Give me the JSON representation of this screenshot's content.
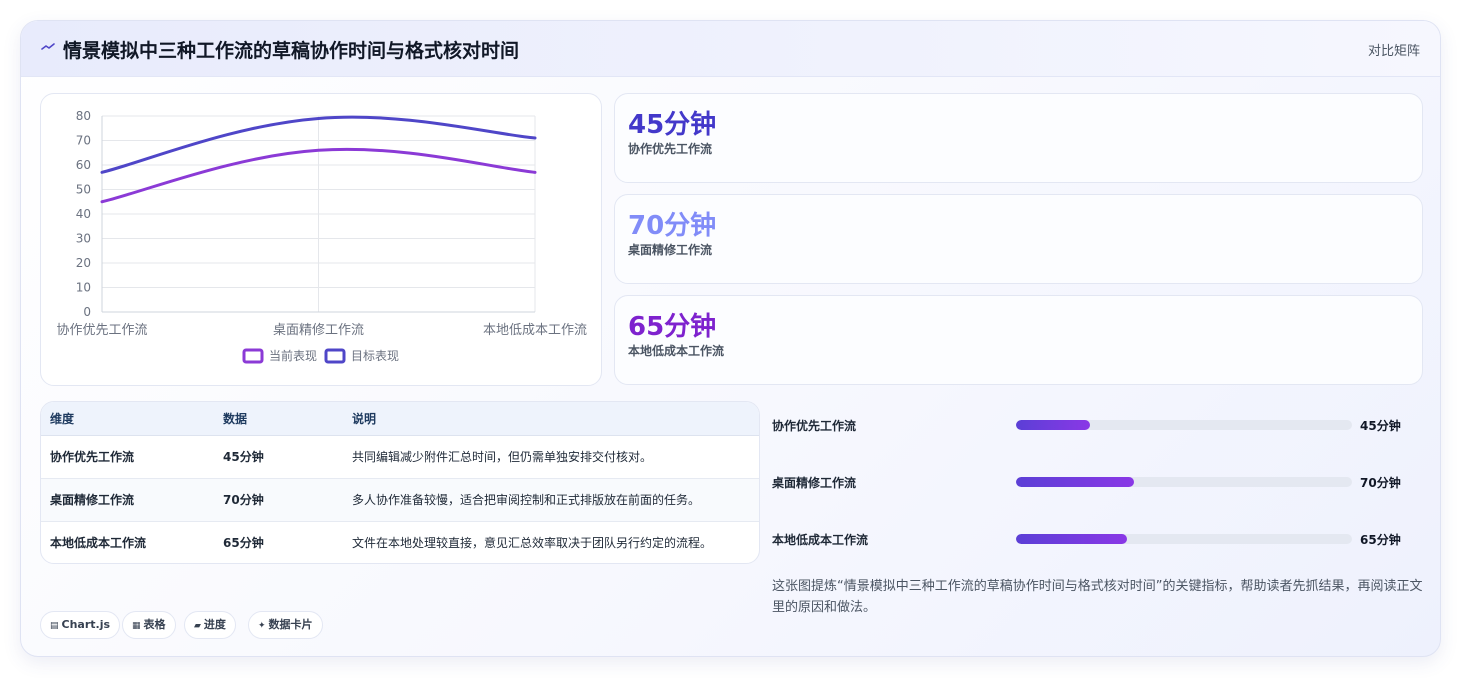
{
  "header": {
    "title": "情景模拟中三种工作流的草稿协作时间与格式核对时间",
    "tag": "对比矩阵"
  },
  "colors": {
    "current": "#8b3ad6",
    "target": "#4f46c8",
    "stat1": "#4338ca",
    "stat2": "#818cf8",
    "stat3": "#7e22ce"
  },
  "chart_data": {
    "type": "line",
    "categories": [
      "协作优先工作流",
      "桌面精修工作流",
      "本地低成本工作流"
    ],
    "series": [
      {
        "name": "当前表现",
        "values": [
          45,
          66,
          57
        ]
      },
      {
        "name": "目标表现",
        "values": [
          57,
          79,
          71
        ]
      }
    ],
    "ylim": [
      0,
      80
    ],
    "yticks": [
      "0",
      "10",
      "20",
      "30",
      "40",
      "50",
      "60",
      "70",
      "80"
    ],
    "grid": true,
    "legend": "bottom"
  },
  "stats": [
    {
      "value": "45分钟",
      "label": "协作优先工作流"
    },
    {
      "value": "70分钟",
      "label": "桌面精修工作流"
    },
    {
      "value": "65分钟",
      "label": "本地低成本工作流"
    }
  ],
  "table": {
    "headers": [
      "维度",
      "数据",
      "说明"
    ],
    "rows": [
      [
        "协作优先工作流",
        "45分钟",
        "共同编辑减少附件汇总时间，但仍需单独安排交付核对。"
      ],
      [
        "桌面精修工作流",
        "70分钟",
        "多人协作准备较慢，适合把审阅控制和正式排版放在前面的任务。"
      ],
      [
        "本地低成本工作流",
        "65分钟",
        "文件在本地处理较直接，意见汇总效率取决于团队另行约定的流程。"
      ]
    ]
  },
  "progress": [
    {
      "label": "协作优先工作流",
      "value": "45分钟",
      "fraction": 0.22
    },
    {
      "label": "桌面精修工作流",
      "value": "70分钟",
      "fraction": 0.35
    },
    {
      "label": "本地低成本工作流",
      "value": "65分钟",
      "fraction": 0.33
    }
  ],
  "note": "这张图提炼“情景模拟中三种工作流的草稿协作时间与格式核对时间”的关键指标，帮助读者先抓结果，再阅读正文里的原因和做法。",
  "chips": [
    {
      "icon": "chart-icon",
      "glyph": "▤",
      "label": "Chart.js"
    },
    {
      "icon": "table-icon",
      "glyph": "▦",
      "label": "表格"
    },
    {
      "icon": "progress-icon",
      "glyph": "▰",
      "label": "进度"
    },
    {
      "icon": "sparkle-icon",
      "glyph": "✦",
      "label": "数据卡片"
    }
  ]
}
